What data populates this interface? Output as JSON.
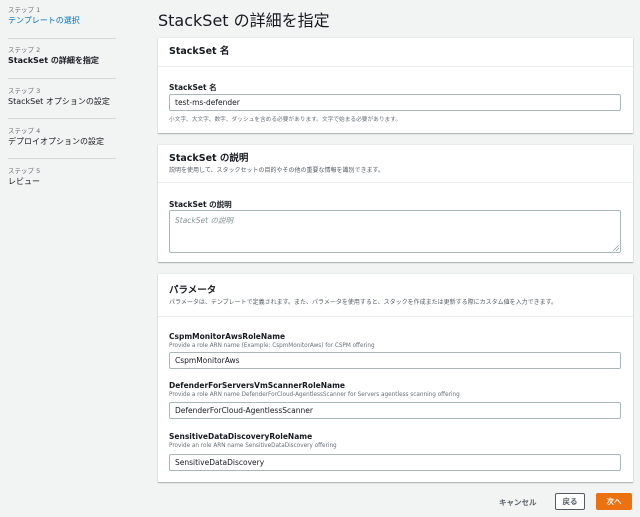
{
  "sidebar": {
    "steps": [
      {
        "num": "ステップ 1",
        "label": "テンプレートの選択"
      },
      {
        "num": "ステップ 2",
        "label": "StackSet の詳細を指定"
      },
      {
        "num": "ステップ 3",
        "label": "StackSet オプションの設定"
      },
      {
        "num": "ステップ 4",
        "label": "デプロイオプションの設定"
      },
      {
        "num": "ステップ 5",
        "label": "レビュー"
      }
    ]
  },
  "page": {
    "title": "StackSet の詳細を指定"
  },
  "name_panel": {
    "title": "StackSet 名",
    "field_label": "StackSet 名",
    "value": "test-ms-defender",
    "hint": "小文字、大文字、数字、ダッシュを含める必要があります。文字で始まる必要があります。"
  },
  "desc_panel": {
    "title": "StackSet の説明",
    "description": "説明を使用して、スタックセットの目的やその他の重要な情報を識別できます。",
    "field_label": "StackSet の説明",
    "placeholder": "StackSet の説明"
  },
  "params_panel": {
    "title": "パラメータ",
    "description": "パラメータは、テンプレートで定義されます。また、パラメータを使用すると、スタックを作成または更新する際にカスタム値を入力できます。",
    "params": [
      {
        "name": "CspmMonitorAwsRoleName",
        "hint": "Provide a role ARN name (Example: CspmMonitorAws) for CSPM offering",
        "value": "CspmMonitorAws"
      },
      {
        "name": "DefenderForServersVmScannerRoleName",
        "hint": "Provide a role ARN name DefenderForCloud-AgentlessScanner for Servers agentless scanning offering",
        "value": "DefenderForCloud-AgentlessScanner"
      },
      {
        "name": "SensitiveDataDiscoveryRoleName",
        "hint": "Provide an role ARN name SensitiveDataDiscovery offering",
        "value": "SensitiveDataDiscovery"
      }
    ]
  },
  "footer": {
    "cancel": "キャンセル",
    "back": "戻る",
    "next": "次へ"
  },
  "colors": {
    "primary": "#ec7211",
    "link": "#0073bb",
    "background": "#f2f3f3"
  }
}
